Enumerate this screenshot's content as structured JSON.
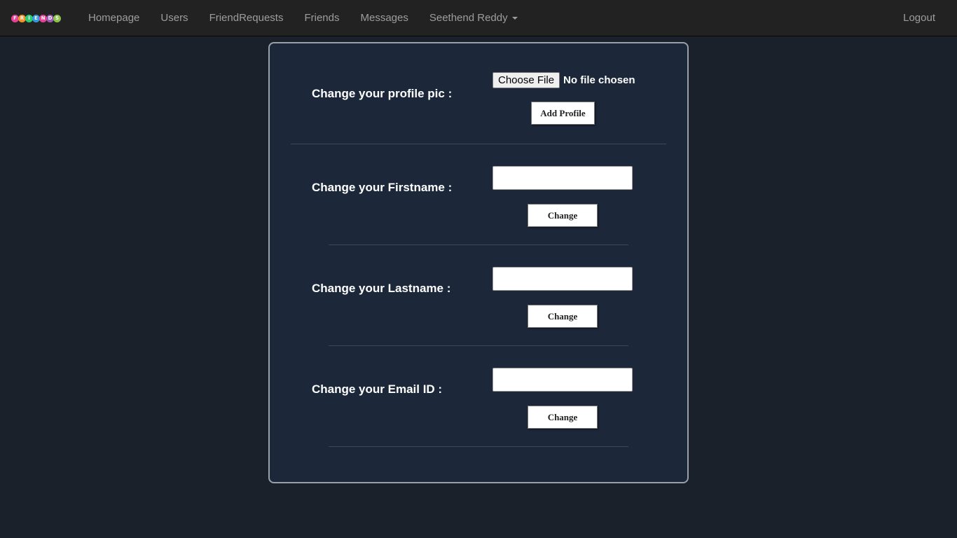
{
  "navbar": {
    "logo_letters": [
      "F",
      "R",
      "I",
      "E",
      "N",
      "D",
      "S"
    ],
    "logo_colors": [
      "#e84393",
      "#f0932b",
      "#2ecc71",
      "#3498db",
      "#e84393",
      "#9b59b6",
      "#8bc34a"
    ],
    "links": [
      "Homepage",
      "Users",
      "FriendRequests",
      "Friends",
      "Messages"
    ],
    "user_menu": "Seethend Reddy",
    "logout": "Logout"
  },
  "form": {
    "profile_pic": {
      "label": "Change your profile pic :",
      "file_button": "Choose File",
      "file_status": "No file chosen",
      "submit": "Add Profile"
    },
    "firstname": {
      "label": "Change your Firstname :",
      "value": "",
      "submit": "Change"
    },
    "lastname": {
      "label": "Change your Lastname :",
      "value": "",
      "submit": "Change"
    },
    "email": {
      "label": "Change your Email ID :",
      "value": "",
      "submit": "Change"
    }
  }
}
